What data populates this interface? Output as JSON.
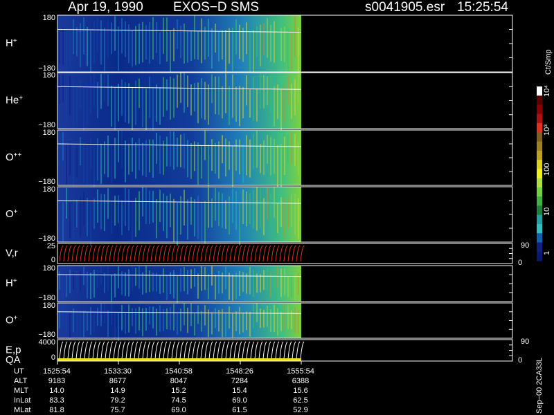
{
  "header": {
    "date": "Apr 19, 1990",
    "instrument": "EXOS−D SMS",
    "file": "s0041905.esr",
    "time": "15:25:54"
  },
  "colorbar": {
    "unit": "Ct/Smp",
    "labels": [
      "10⁴",
      "10³",
      "100",
      "10",
      "1"
    ]
  },
  "footer_code": "Sep−00 2CA33L",
  "chart_data": {
    "type": "heatmap",
    "title": "Apr 19, 1990   EXOS−D SMS",
    "time_axis": [
      "1525:54",
      "1533:30",
      "1540:58",
      "1548:26",
      "1555:54"
    ],
    "panels": [
      {
        "label": "H",
        "charge": "+",
        "ymax": "180",
        "ymin": "−180"
      },
      {
        "label": "He",
        "charge": "+",
        "ymax": "180",
        "ymin": "−180"
      },
      {
        "label": "O",
        "charge": "++",
        "ymax": "180",
        "ymin": "−180"
      },
      {
        "label": "O",
        "charge": "+",
        "ymax": "180",
        "ymin": "−180"
      },
      {
        "label": "V,r",
        "charge": "",
        "ymax": "25",
        "ymin": "0",
        "right_max": "90",
        "right_min": "0"
      },
      {
        "label": "H",
        "charge": "+",
        "ymax": "180",
        "ymin": "−180"
      },
      {
        "label": "O",
        "charge": "+",
        "ymax": "180",
        "ymin": "−180"
      },
      {
        "label": "E,p",
        "label2": "QA",
        "charge": "",
        "ymax": "4000",
        "ymin": "0",
        "right_max": "90",
        "right_min": "0"
      }
    ],
    "ephemeris": [
      {
        "name": "UT",
        "values": [
          "1525:54",
          "1533:30",
          "1540:58",
          "1548:26",
          "1555:54"
        ]
      },
      {
        "name": "ALT",
        "values": [
          "9183",
          "8677",
          "8047",
          "7284",
          "6388"
        ]
      },
      {
        "name": "MLT",
        "values": [
          "14.0",
          "14.9",
          "15.2",
          "15.4",
          "15.6"
        ]
      },
      {
        "name": "InLat",
        "values": [
          "83.3",
          "79.2",
          "74.5",
          "69.0",
          "62.5"
        ]
      },
      {
        "name": "MLat",
        "values": [
          "81.8",
          "75.7",
          "69.0",
          "61.5",
          "52.9"
        ]
      }
    ]
  }
}
